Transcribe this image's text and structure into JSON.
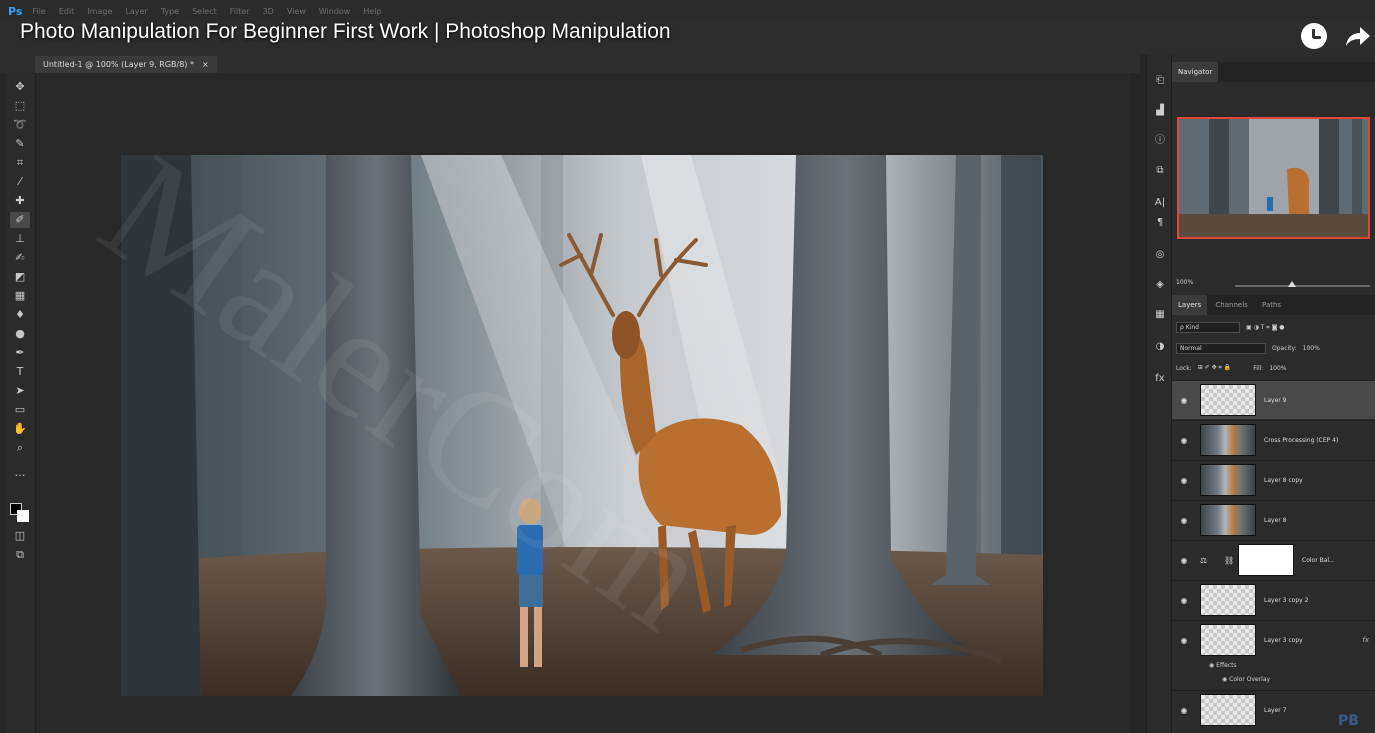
{
  "app": {
    "logo": "Ps"
  },
  "menu": [
    "File",
    "Edit",
    "Image",
    "Layer",
    "Type",
    "Select",
    "Filter",
    "3D",
    "View",
    "Window",
    "Help"
  ],
  "video_title": "Photo Manipulation For Beginner First Work | Photoshop Manipulation",
  "document_tab": {
    "title": "Untitled-1 @ 100% (Layer 9, RGB/8) *",
    "close": "×"
  },
  "toolbox_icons": [
    "move-icon",
    "marquee-icon",
    "lasso-icon",
    "quick-select-icon",
    "crop-icon",
    "eyedropper-icon",
    "healing-icon",
    "brush-icon",
    "stamp-icon",
    "history-brush-icon",
    "eraser-icon",
    "gradient-icon",
    "blur-icon",
    "dodge-icon",
    "pen-icon",
    "type-icon",
    "path-select-icon",
    "rectangle-icon",
    "hand-icon",
    "zoom-icon",
    "more-icon"
  ],
  "watermark": "MalerCom",
  "navigator": {
    "tab": "Navigator",
    "zoom": "100%",
    "zoom_level": 0.42
  },
  "layers_panel": {
    "tabs": [
      "Layers",
      "Channels",
      "Paths"
    ],
    "filter_kind": "ρ Kind",
    "blend_mode": "Normal",
    "opacity_label": "Opacity:",
    "opacity": "100%",
    "lock_label": "Lock:",
    "fill_label": "Fill:",
    "fill": "100%",
    "layers": [
      {
        "name": "Layer 9",
        "thumb": "transparent",
        "selected": true
      },
      {
        "name": "Cross Processing (CEP 4)",
        "thumb": "image"
      },
      {
        "name": "Layer 8 copy",
        "thumb": "image"
      },
      {
        "name": "Layer 8",
        "thumb": "image"
      },
      {
        "name": "Color Bal...",
        "thumb": "adjustment"
      },
      {
        "name": "Layer 3 copy 2",
        "thumb": "transparent"
      },
      {
        "name": "Layer 3 copy",
        "thumb": "transparent",
        "fx": "fx"
      },
      {
        "name": "Layer 7",
        "thumb": "transparent"
      }
    ],
    "effects_label": "Effects",
    "effect_item": "Color Overlay"
  },
  "corner_logo": "PB",
  "colors": {
    "accent_red": "#e0473a",
    "ps_blue": "#2fa3f7"
  }
}
